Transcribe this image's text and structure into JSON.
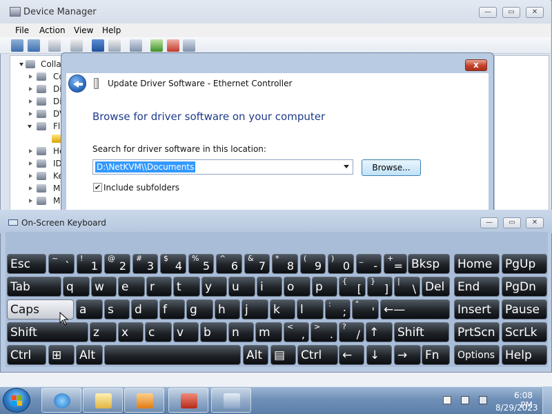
{
  "device_manager": {
    "title": "Device Manager",
    "menu": [
      "File",
      "Action",
      "View",
      "Help"
    ],
    "tree": {
      "root": "Collab",
      "items": [
        "Co",
        "Di",
        "Di",
        "DV",
        "Fl",
        "",
        "He",
        "ID",
        "Ke",
        "M",
        "M",
        "M"
      ]
    }
  },
  "dialog": {
    "title": "Update Driver Software - Ethernet Controller",
    "close_label": "x",
    "heading": "Browse for driver software on your computer",
    "search_label": "Search for driver software in this location:",
    "path_value": "D:\\NetKVM\\\\Documents",
    "browse_label": "Browse...",
    "include_subfolders_label": "Include subfolders",
    "include_subfolders_checked": true
  },
  "window_controls": {
    "minimize": "—",
    "maximize": "▭",
    "close": "✕"
  },
  "osk": {
    "title": "On-Screen Keyboard",
    "rows": [
      [
        {
          "main": "Esc"
        },
        {
          "top": "~",
          "main": "`"
        },
        {
          "top": "!",
          "main": "1"
        },
        {
          "top": "@",
          "main": "2"
        },
        {
          "top": "#",
          "main": "3"
        },
        {
          "top": "$",
          "main": "4"
        },
        {
          "top": "%",
          "main": "5"
        },
        {
          "top": "^",
          "main": "6"
        },
        {
          "top": "&",
          "main": "7"
        },
        {
          "top": "*",
          "main": "8"
        },
        {
          "top": "(",
          "main": "9"
        },
        {
          "top": ")",
          "main": "0"
        },
        {
          "top": "_",
          "main": "-"
        },
        {
          "top": "+",
          "main": "="
        },
        {
          "main": "Bksp"
        },
        {
          "main": "Home"
        },
        {
          "main": "PgUp"
        }
      ],
      [
        {
          "main": "Tab"
        },
        {
          "main": "q"
        },
        {
          "main": "w"
        },
        {
          "main": "e"
        },
        {
          "main": "r"
        },
        {
          "main": "t"
        },
        {
          "main": "y"
        },
        {
          "main": "u"
        },
        {
          "main": "i"
        },
        {
          "main": "o"
        },
        {
          "main": "p"
        },
        {
          "top": "{",
          "main": "["
        },
        {
          "top": "}",
          "main": "]"
        },
        {
          "top": "|",
          "main": "\\"
        },
        {
          "main": "Del"
        },
        {
          "main": "End"
        },
        {
          "main": "PgDn"
        }
      ],
      [
        {
          "main": "Caps"
        },
        {
          "main": "a"
        },
        {
          "main": "s"
        },
        {
          "main": "d"
        },
        {
          "main": "f"
        },
        {
          "main": "g"
        },
        {
          "main": "h"
        },
        {
          "main": "j"
        },
        {
          "main": "k"
        },
        {
          "main": "l"
        },
        {
          "top": ":",
          "main": ";"
        },
        {
          "top": "\"",
          "main": "'"
        },
        {
          "main": "←—"
        },
        {
          "main": "Insert"
        },
        {
          "main": "Pause"
        }
      ],
      [
        {
          "main": "Shift"
        },
        {
          "main": "z"
        },
        {
          "main": "x"
        },
        {
          "main": "c"
        },
        {
          "main": "v"
        },
        {
          "main": "b"
        },
        {
          "main": "n"
        },
        {
          "main": "m"
        },
        {
          "top": "<",
          "main": ","
        },
        {
          "top": ">",
          "main": "."
        },
        {
          "top": "?",
          "main": "/"
        },
        {
          "main": "↑"
        },
        {
          "main": "Shift"
        },
        {
          "main": "PrtScn"
        },
        {
          "main": "ScrLk"
        }
      ],
      [
        {
          "main": "Ctrl"
        },
        {
          "main": "⊞"
        },
        {
          "main": "Alt"
        },
        {
          "main": ""
        },
        {
          "main": "Alt"
        },
        {
          "main": "▤"
        },
        {
          "main": "Ctrl"
        },
        {
          "main": "←"
        },
        {
          "main": "↓"
        },
        {
          "main": "→"
        },
        {
          "main": "Fn"
        },
        {
          "main": "Options"
        },
        {
          "main": "Help"
        }
      ]
    ]
  },
  "taskbar": {
    "time": "6:08 PM",
    "date": "8/29/2023"
  }
}
